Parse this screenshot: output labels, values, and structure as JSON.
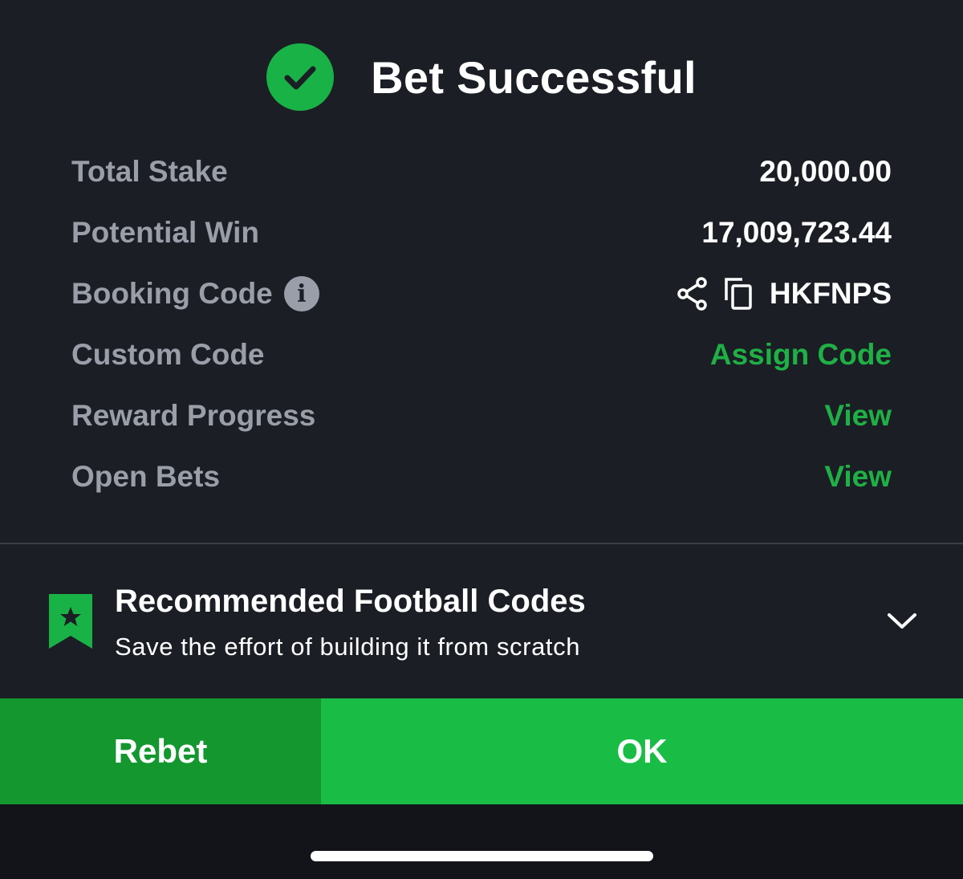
{
  "header": {
    "title": "Bet Successful",
    "icon": "check-circle-icon",
    "accent": "#19b246"
  },
  "summary": {
    "total_stake": {
      "label": "Total Stake",
      "value": "20,000.00"
    },
    "potential_win": {
      "label": "Potential Win",
      "value": "17,009,723.44"
    },
    "booking_code": {
      "label": "Booking Code",
      "info": "i",
      "value": "HKFNPS"
    },
    "custom_code": {
      "label": "Custom Code",
      "action": "Assign Code"
    },
    "reward_progress": {
      "label": "Reward Progress",
      "action": "View"
    },
    "open_bets": {
      "label": "Open Bets",
      "action": "View"
    }
  },
  "recommended": {
    "title": "Recommended Football Codes",
    "subtitle": "Save the effort of building it from scratch",
    "icon": "bookmark-star-icon"
  },
  "buttons": {
    "rebet": "Rebet",
    "ok": "OK"
  },
  "colors": {
    "background": "#1b1e25",
    "link_green": "#1fb045",
    "rebet_bg": "#14972f",
    "ok_bg": "#19bd46"
  }
}
